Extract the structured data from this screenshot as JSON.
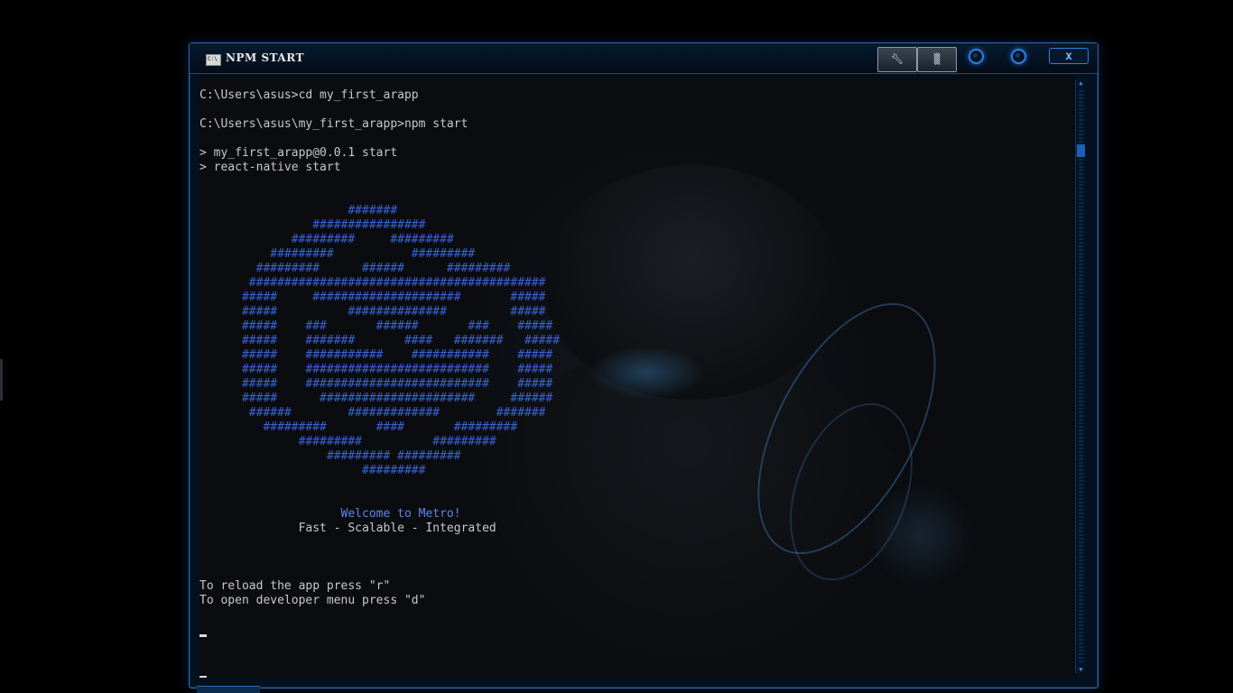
{
  "window": {
    "title": "NPM START",
    "buttons": {
      "tools_icon": "wrench-icon",
      "settings_icon": "grid-icon",
      "close_label": "x"
    }
  },
  "console": {
    "lines": [
      "C:\\Users\\asus>cd my_first_arapp",
      "",
      "C:\\Users\\asus\\my_first_arapp>npm start",
      "",
      "> my_first_arapp@0.0.1 start",
      "> react-native start",
      "",
      ""
    ],
    "logo": [
      "                     #######",
      "                ################",
      "             #########     #########",
      "          #########           #########",
      "        #########      ######      #########",
      "       ##########################################",
      "      #####     #####################       #####",
      "      #####          ##############         #####",
      "      #####    ###       ######       ###    #####",
      "      #####    #######       ####   #######   #####",
      "      #####    ###########    ###########    #####",
      "      #####    ##########################    #####",
      "      #####    ##########################    #####",
      "      #####      ######################     ######",
      "       ######        #############        #######",
      "         #########       ####       #########",
      "              #########          #########",
      "                  ######### #########",
      "                       #########"
    ],
    "welcome": "Welcome to Metro!",
    "tagline": "Fast - Scalable - Integrated",
    "hint_reload": "To reload the app press \"r\"",
    "hint_devmenu": "To open developer menu press \"d\""
  },
  "colors": {
    "logo": "#3a63d8",
    "welcome": "#5c86f0",
    "text": "#c8c8c8",
    "frame": "#2f6bb0"
  }
}
